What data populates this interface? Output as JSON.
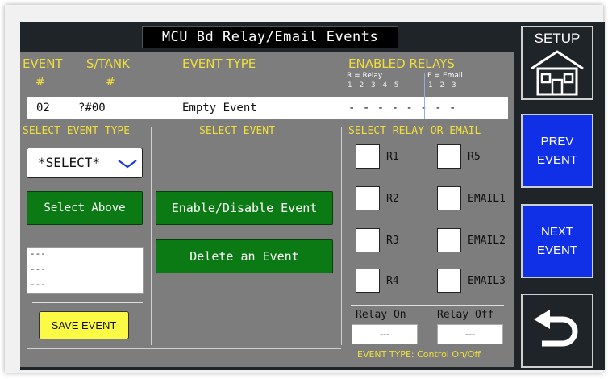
{
  "title": "MCU Bd Relay/Email Events",
  "headers": {
    "event": "EVENT",
    "event_hash": "#",
    "stank": "S/TANK",
    "stank_hash": "#",
    "event_type": "EVENT TYPE",
    "enabled_relays": "ENABLED RELAYS",
    "r_legend": "R = Relay",
    "e_legend": "E = Email",
    "r_nums": "1  2  3  4  5",
    "e_nums": "1  2  3"
  },
  "event_row": {
    "number": "02",
    "stank": "?#00",
    "type": "Empty Event",
    "relays": "- - - - - - - -"
  },
  "select_event_type": {
    "heading": "SELECT EVENT TYPE",
    "dropdown_value": "*SELECT*",
    "select_above_label": "Select Above",
    "list_items": [
      "---",
      "---",
      "---"
    ],
    "save_label": "SAVE EVENT"
  },
  "select_event": {
    "heading": "SELECT EVENT",
    "enable_disable_label": "Enable/Disable Event",
    "delete_label": "Delete an Event"
  },
  "select_relay": {
    "heading": "SELECT RELAY OR EMAIL",
    "options": [
      "R1",
      "R5",
      "R2",
      "EMAIL1",
      "R3",
      "EMAIL2",
      "R4",
      "EMAIL3"
    ],
    "relay_on_label": "Relay On",
    "relay_off_label": "Relay Off",
    "relay_on_value": "---",
    "relay_off_value": "---",
    "event_type_note": "EVENT TYPE: Control On/Off"
  },
  "sidebar": {
    "setup_label": "SETUP",
    "prev_label_1": "PREV",
    "prev_label_2": "EVENT",
    "next_label_1": "NEXT",
    "next_label_2": "EVENT",
    "back_icon": "back-arrow-icon",
    "home_icon": "house-icon"
  },
  "colors": {
    "accent_yellow": "#f2df3a",
    "button_green": "#0c7a14",
    "side_blue": "#1030e8",
    "panel_gray": "#7d7d7d",
    "background_dark": "#1f2428"
  }
}
